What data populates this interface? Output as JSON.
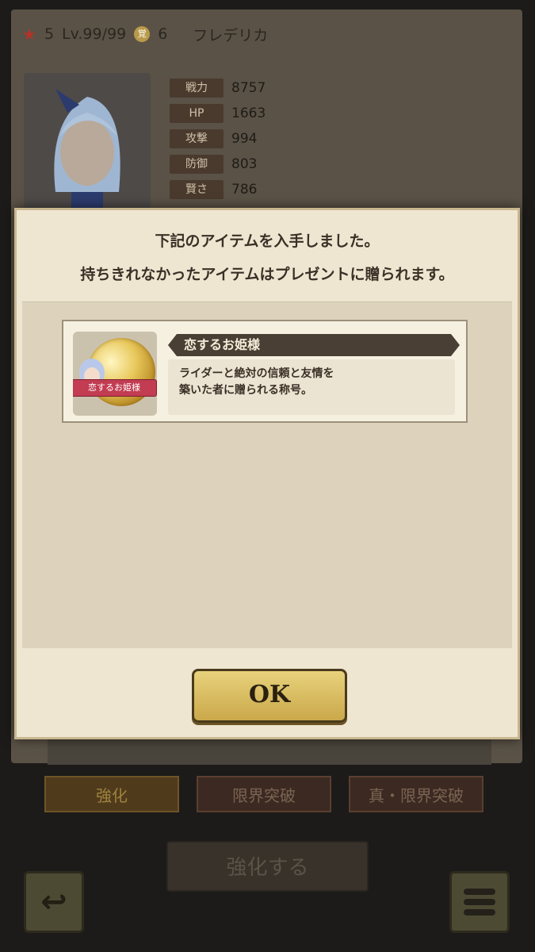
{
  "header": {
    "rarity": "5",
    "level": "Lv.99/99",
    "rank": "6",
    "character_name": "フレデリカ"
  },
  "stats": [
    {
      "label": "戦力",
      "value": "8757"
    },
    {
      "label": "HP",
      "value": "1663"
    },
    {
      "label": "攻撃",
      "value": "994"
    },
    {
      "label": "防御",
      "value": "803"
    },
    {
      "label": "賢さ",
      "value": "786"
    }
  ],
  "tabs": [
    {
      "label": "強化"
    },
    {
      "label": "限界突破"
    },
    {
      "label": "真・限界突破"
    }
  ],
  "enhance_button": "強化する",
  "modal": {
    "line1": "下記のアイテムを入手しました。",
    "line2": "持ちきれなかったアイテムはプレゼントに贈られます。",
    "item": {
      "ribbon_label": "恋するお姫様",
      "title": "恋するお姫様",
      "description_line1": "ライダーと絶対の信頼と友情を",
      "description_line2": "築いた者に贈られる称号。"
    },
    "ok_label": "OK"
  },
  "icons": [
    "star-icon",
    "rank-badge-icon",
    "back-icon",
    "menu-icon",
    "title-medal-icon"
  ]
}
